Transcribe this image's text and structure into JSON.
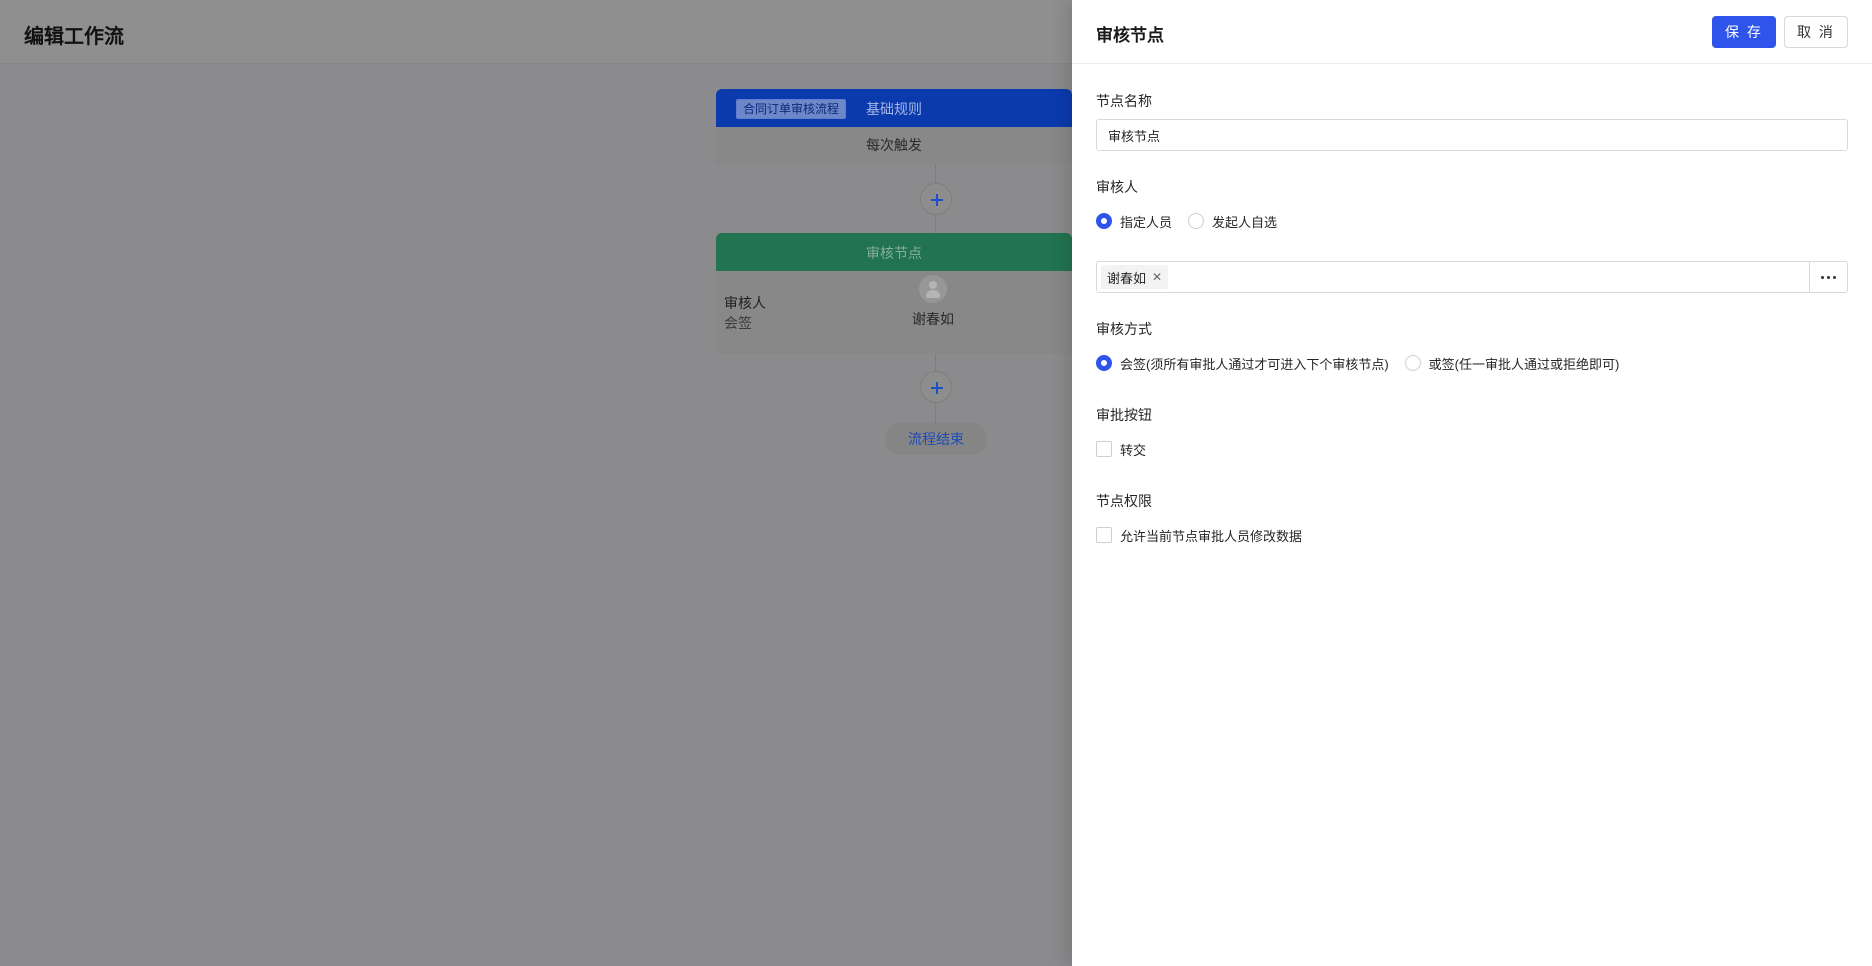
{
  "page": {
    "title": "编辑工作流"
  },
  "flow": {
    "trigger_card": {
      "tag": "合同订单审核流程",
      "title": "基础规则",
      "body": "每次触发"
    },
    "approval_card": {
      "title": "审核节点",
      "label_role": "审核人",
      "label_mode": "会签",
      "person": "谢春如"
    },
    "end_label": "流程结束"
  },
  "drawer": {
    "title": "审核节点",
    "save_label": "保 存",
    "cancel_label": "取 消",
    "node_name": {
      "label": "节点名称",
      "value": "审核节点"
    },
    "approver": {
      "label": "审核人",
      "options": [
        {
          "label": "指定人员",
          "checked": true
        },
        {
          "label": "发起人自选",
          "checked": false
        }
      ],
      "selected_people": [
        "谢春如"
      ]
    },
    "approval_mode": {
      "label": "审核方式",
      "options": [
        {
          "label": "会签(须所有审批人通过才可进入下个审核节点)",
          "checked": true
        },
        {
          "label": "或签(任一审批人通过或拒绝即可)",
          "checked": false
        }
      ]
    },
    "approval_buttons": {
      "label": "审批按钮",
      "options": [
        {
          "label": "转交",
          "checked": false
        }
      ]
    },
    "node_permission": {
      "label": "节点权限",
      "options": [
        {
          "label": "允许当前节点审批人员修改数据",
          "checked": false
        }
      ]
    }
  },
  "colors": {
    "primary": "#2f54eb",
    "trigger_header": "#0b3aad",
    "approval_header": "#227350",
    "overlay": "#8b8b8d"
  }
}
